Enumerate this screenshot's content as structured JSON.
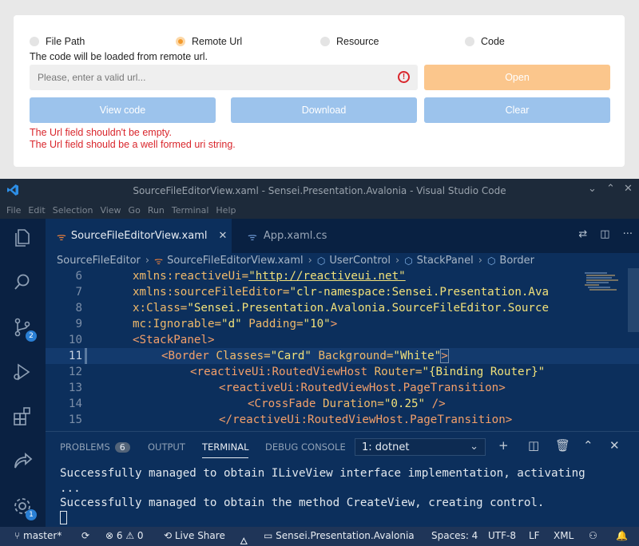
{
  "app": {
    "radios": [
      {
        "label": "File Path",
        "checked": false
      },
      {
        "label": "Remote Url",
        "checked": true
      },
      {
        "label": "Resource",
        "checked": false
      },
      {
        "label": "Code",
        "checked": false
      }
    ],
    "hint": "The code will be loaded from remote url.",
    "url_placeholder": "Please, enter a valid url...",
    "open_label": "Open",
    "view_code_label": "View code",
    "download_label": "Download",
    "clear_label": "Clear",
    "errors": [
      "The Url field shouldn't be empty.",
      "The Url field should be a well formed uri string."
    ],
    "colors": {
      "accent": "#f39a2c",
      "button_blue": "#9cc3ec",
      "error": "#d9262c"
    }
  },
  "vscode": {
    "title": "SourceFileEditorView.xaml - Sensei.Presentation.Avalonia - Visual Studio Code",
    "menu": [
      "File",
      "Edit",
      "Selection",
      "View",
      "Go",
      "Run",
      "Terminal",
      "Help"
    ],
    "activity_badges": {
      "scm": "2",
      "settings": "1"
    },
    "tabs": [
      {
        "label": "SourceFileEditorView.xaml",
        "active": true
      },
      {
        "label": "App.xaml.cs",
        "active": false
      }
    ],
    "breadcrumb": [
      "SourceFileEditor",
      "SourceFileEditorView.xaml",
      "UserControl",
      "StackPanel",
      "Border"
    ],
    "lines": [
      {
        "num": "6"
      },
      {
        "num": "7"
      },
      {
        "num": "8"
      },
      {
        "num": "9"
      },
      {
        "num": "10"
      },
      {
        "num": "11"
      },
      {
        "num": "12"
      },
      {
        "num": "13"
      },
      {
        "num": "14"
      },
      {
        "num": "15"
      }
    ],
    "code": {
      "l6_attr": "xmlns:reactiveUi=",
      "l6_val": "\"http://reactiveui.net\"",
      "l7_attr": "xmlns:sourceFileEditor=",
      "l7_val": "\"clr-namespace:Sensei.Presentation.Ava",
      "l8_attr": "x:Class=",
      "l8_val": "\"Sensei.Presentation.Avalonia.SourceFileEditor.Source",
      "l9_attr1": "mc:Ignorable=",
      "l9_val1": "\"d\"",
      "l9_attr2": " Padding=",
      "l9_val2": "\"10\"",
      "l9_close": ">",
      "l10_tag": "<StackPanel>",
      "l11_open": "<Border",
      "l11_attr1": " Classes=",
      "l11_val1": "\"Card\"",
      "l11_attr2": " Background=",
      "l11_val2": "\"White\"",
      "l11_close": ">",
      "l12_open": "<reactiveUi:RoutedViewHost",
      "l12_attr": " Router=",
      "l12_val": "\"{Binding Router}\"",
      "l13_tag": "<reactiveUi:RoutedViewHost.PageTransition>",
      "l14_open": "<CrossFade",
      "l14_attr": " Duration=",
      "l14_val": "\"0.25\"",
      "l14_close": " />",
      "l15_tag": "</reactiveUi:RoutedViewHost.PageTransition>"
    },
    "panel": {
      "tabs": [
        "PROBLEMS",
        "OUTPUT",
        "TERMINAL",
        "DEBUG CONSOLE"
      ],
      "problems_count": "6",
      "active_tab": "TERMINAL",
      "terminal_select": "1: dotnet",
      "terminal_lines": [
        "Successfully managed to obtain ILiveView interface implementation, activating",
        "...",
        "Successfully managed to obtain the method CreateView, creating control."
      ]
    },
    "status": {
      "branch": "master*",
      "errors": "6",
      "warnings": "0",
      "live_share": "Live Share",
      "project": "Sensei.Presentation.Avalonia",
      "spaces": "Spaces: 4",
      "encoding": "UTF-8",
      "eol": "LF",
      "language": "XML"
    }
  }
}
